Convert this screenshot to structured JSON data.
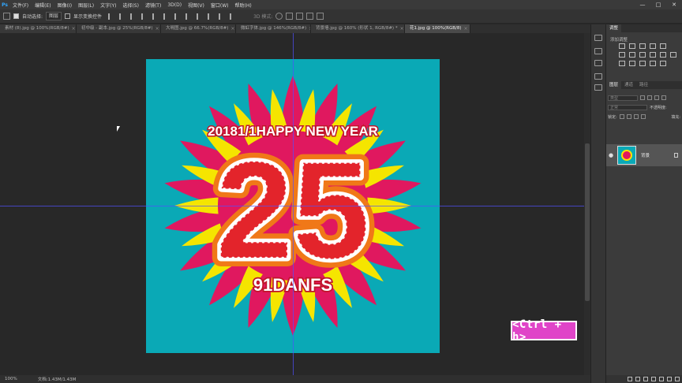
{
  "menubar": {
    "logo": "Ps",
    "items": [
      "文件(F)",
      "编辑(E)",
      "图像(I)",
      "图层(L)",
      "文字(Y)",
      "选择(S)",
      "滤镜(T)",
      "3D(D)",
      "视图(V)",
      "窗口(W)",
      "帮助(H)"
    ],
    "win_minimize": "—",
    "win_restore": "□",
    "win_close": "✕"
  },
  "options": {
    "auto_select_label": "自动选择:",
    "auto_select_value": "图层",
    "show_transform_label": "显示变换控件",
    "mode_3d_label": "3D 模式:"
  },
  "tabs": [
    {
      "label": "素材 (8).jpg @ 100%(RGB/8#)",
      "active": false
    },
    {
      "label": "初中级 - 副本.jpg @ 25%(RGB/8#)",
      "active": false
    },
    {
      "label": "大嗝图.jpg @ 66.7%(RGB/8#)",
      "active": false
    },
    {
      "label": "微虹字体.jpg @ 146%(RGB/8#)",
      "active": false
    },
    {
      "label": "背景墙.jpg @ 160% (形状 1, RGB/8#) *",
      "active": false
    },
    {
      "label": "花1.jpg @ 100%(RGB/8)",
      "active": true
    }
  ],
  "artwork": {
    "headline": "20181/1HAPPY NEW YEAR",
    "big_number": "25",
    "footer": "91DANFS",
    "colors": {
      "background": "#0aa9b6",
      "petal_pink": "#e0185f",
      "petal_yellow": "#f5e500",
      "number_red": "#e3242b",
      "number_stroke": "#ffffff",
      "outline_orange": "#f07818"
    }
  },
  "status": {
    "zoom": "100%",
    "doc_info": "文档:1.43M/1.43M"
  },
  "panels": {
    "adjust_tab": "调整",
    "adjust_title": "添加调整",
    "layer_tabs": [
      "图层",
      "通道",
      "路径"
    ],
    "kind_label": "类型",
    "blend_mode": "正常",
    "opacity_label": "不透明度:",
    "lock_label": "锁定:",
    "fill_label": "填充:",
    "layer_name": "背景"
  },
  "shortcut": {
    "text": "<Ctrl + h>"
  }
}
